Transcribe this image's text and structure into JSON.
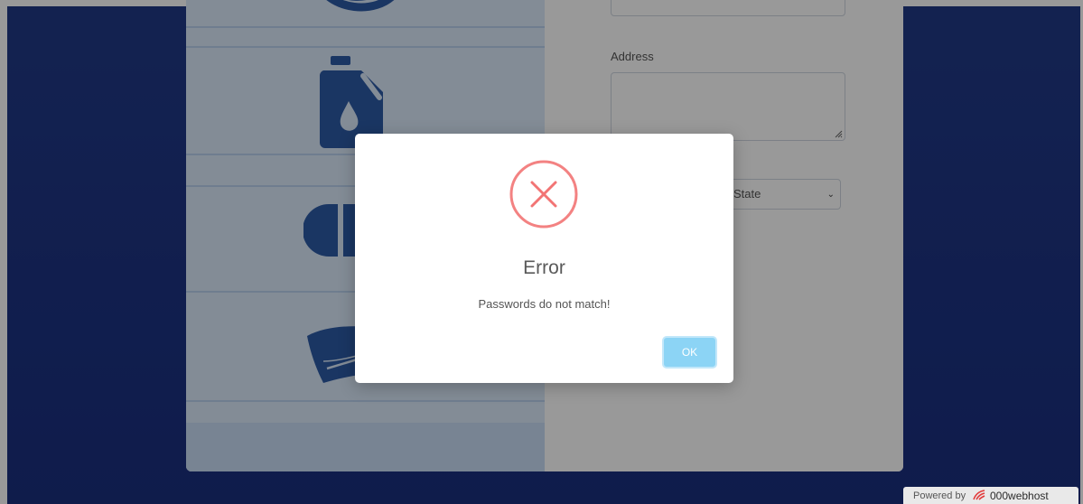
{
  "form": {
    "address_label": "Address",
    "state_placeholder": "State"
  },
  "icons": [
    "oil-ring-icon",
    "oil-canister-icon",
    "capsule-icon",
    "windshield-icon"
  ],
  "modal": {
    "title": "Error",
    "message": "Passwords do not match!",
    "ok_label": "OK",
    "icon": "error-x-icon",
    "accent_color": "#f27474",
    "button_color": "#8cd4f5"
  },
  "footer": {
    "powered_by": "Powered by",
    "brand": "000webhost"
  }
}
